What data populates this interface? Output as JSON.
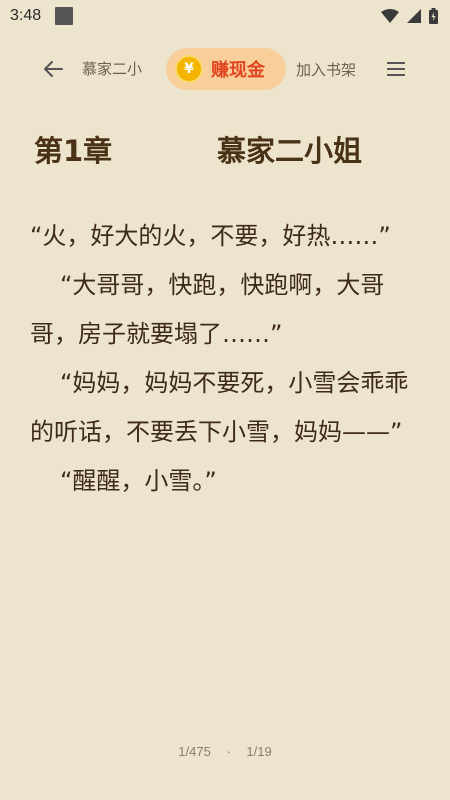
{
  "status_bar": {
    "time": "3:48"
  },
  "toolbar": {
    "book_title": "慕家二小",
    "earn_label": "赚现金",
    "coin_symbol": "¥",
    "add_shelf_label": "加入书架"
  },
  "chapter": {
    "number": "第1章",
    "title": "慕家二小姐"
  },
  "paragraphs": [
    "“火，好大的火，不要，好热……”",
    "“大哥哥，快跑，快跑啊，大哥哥，房子就要塌了……”",
    "“妈妈，妈妈不要死，小雪会乖乖的听话，不要丢下小雪，妈妈——”",
    "“醒醒，小雪。”"
  ],
  "footer": {
    "chapter_progress": "1/475",
    "separator": "·",
    "page_progress": "1/19"
  },
  "colors": {
    "background": "#ede4cd",
    "text": "#3d2a17",
    "earn_bg": "#f8cf9a",
    "earn_text": "#e0451f",
    "coin": "#f5b400"
  }
}
